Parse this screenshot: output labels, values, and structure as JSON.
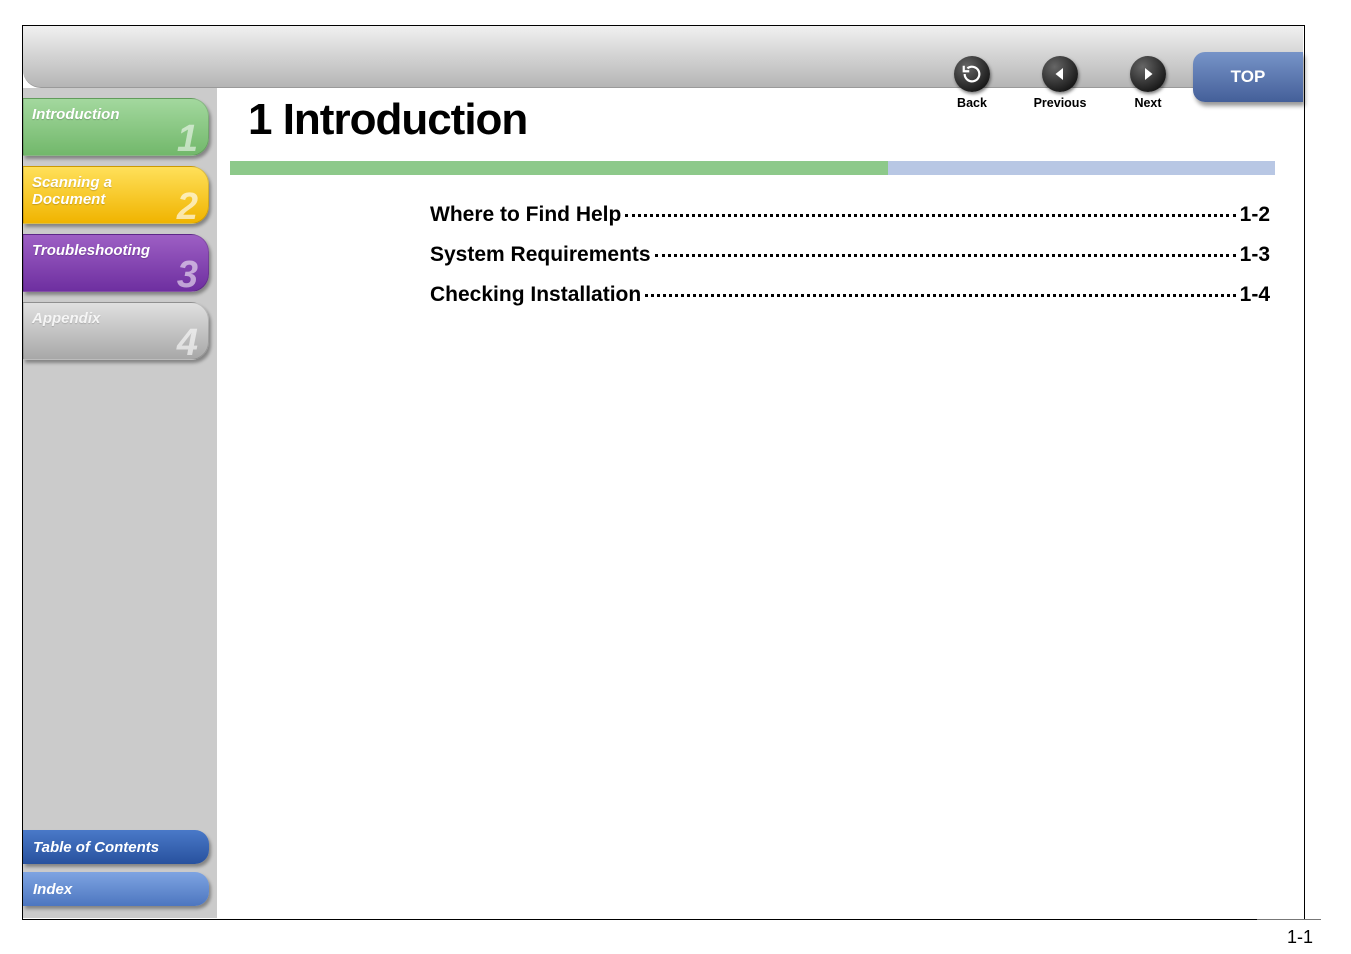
{
  "nav": {
    "back": "Back",
    "previous": "Previous",
    "next": "Next",
    "top": "TOP"
  },
  "sidebar": {
    "chapters": [
      {
        "label": "Introduction",
        "num": "1"
      },
      {
        "label": "Scanning a\nDocument",
        "num": "2"
      },
      {
        "label": "Troubleshooting",
        "num": "3"
      },
      {
        "label": "Appendix",
        "num": "4"
      }
    ],
    "toc_label": "Table of Contents",
    "index_label": "Index"
  },
  "main": {
    "title": "1 Introduction",
    "toc": [
      {
        "title": "Where to Find Help",
        "page": "1-2"
      },
      {
        "title": "System Requirements",
        "page": "1-3"
      },
      {
        "title": "Checking Installation",
        "page": "1-4"
      }
    ]
  },
  "page_number": "1-1"
}
